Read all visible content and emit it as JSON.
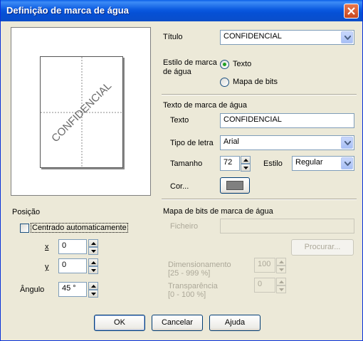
{
  "window": {
    "title": "Definição de marca de água"
  },
  "preview": {
    "watermark_text": "CONFIDENCIAL"
  },
  "title_field": {
    "label": "Título",
    "value": "CONFIDENCIAL"
  },
  "style": {
    "label_line1": "Estilo de marca",
    "label_line2": "de água",
    "option_text": "Texto",
    "option_bitmap": "Mapa de bits",
    "selected": "Texto"
  },
  "text_section": {
    "heading": "Texto de marca de água",
    "text_label": "Texto",
    "text_value": "CONFIDENCIAL",
    "font_label": "Tipo de letra",
    "font_value": "Arial",
    "size_label": "Tamanho",
    "size_value": "72",
    "style_label": "Estilo",
    "style_value": "Regular",
    "color_label": "Cor...",
    "color_swatch": "#808080"
  },
  "bitmap_section": {
    "heading": "Mapa de bits de marca de água",
    "file_label": "Ficheiro",
    "file_value": "",
    "browse_label": "Procurar...",
    "scale_label_line1": "Dimensionamento",
    "scale_label_line2": "[25 - 999 %]",
    "scale_value": "100",
    "transparency_label_line1": "Transparência",
    "transparency_label_line2": "[0 - 100 %]",
    "transparency_value": "0"
  },
  "position": {
    "heading": "Posição",
    "auto_center_label": "Centrado automaticamente",
    "auto_center_checked": false,
    "x_label": "x",
    "x_value": "0",
    "y_label": "y",
    "y_value": "0",
    "angle_label": "Ângulo",
    "angle_value": "45 °"
  },
  "buttons": {
    "ok": "OK",
    "cancel": "Cancelar",
    "help": "Ajuda"
  }
}
